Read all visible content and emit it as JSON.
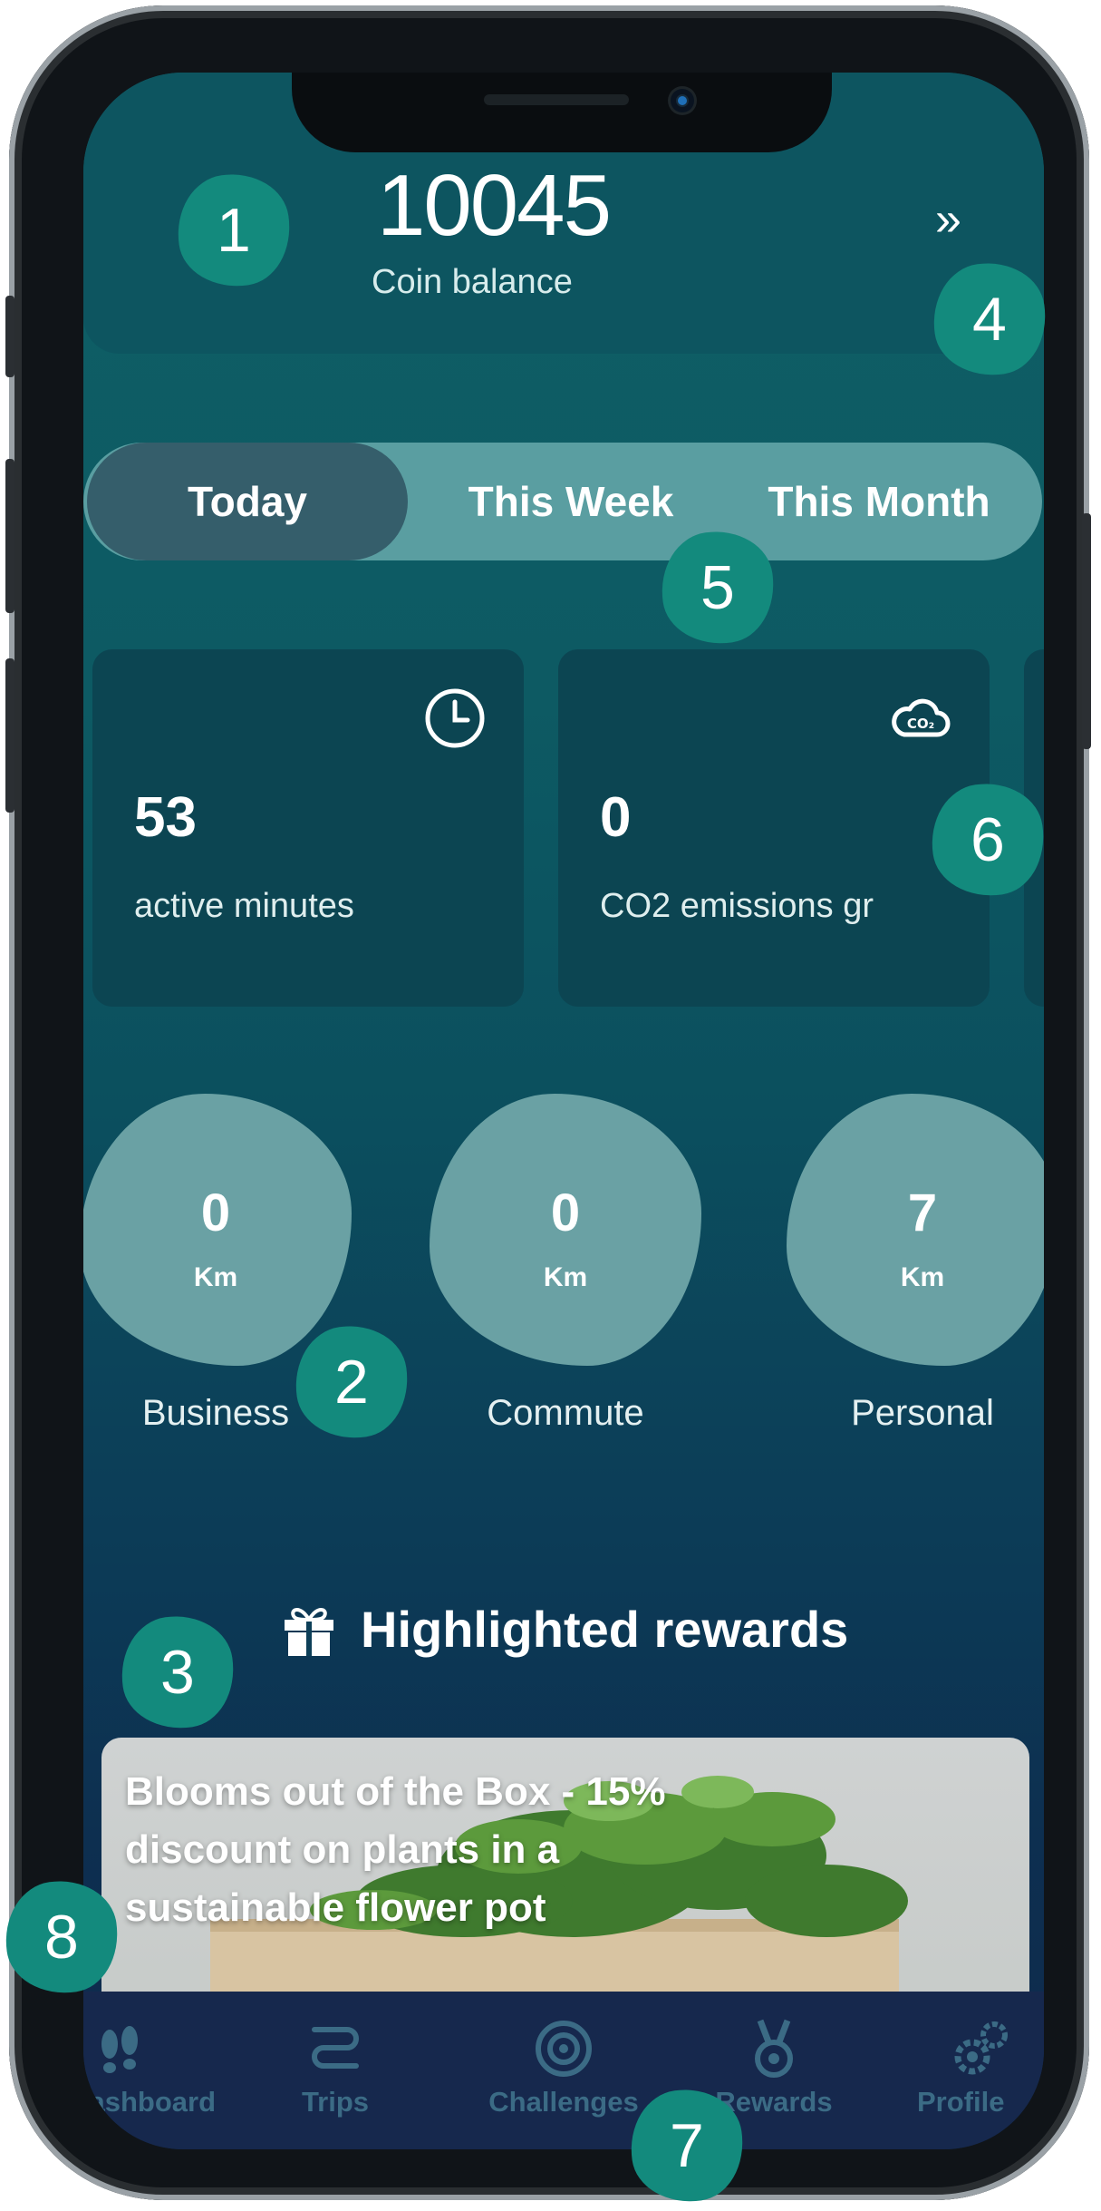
{
  "header": {
    "coin_value": "10045",
    "coin_label": "Coin balance",
    "expand_label": "»"
  },
  "period_tabs": [
    {
      "label": "Today",
      "active": true
    },
    {
      "label": "This Week",
      "active": false
    },
    {
      "label": "This Month",
      "active": false
    }
  ],
  "stats": [
    {
      "value": "53",
      "label": "active minutes",
      "icon": "clock-icon"
    },
    {
      "value": "0",
      "label": "CO2 emissions gr",
      "icon": "co2-cloud-icon"
    }
  ],
  "trip_types": [
    {
      "value": "0",
      "unit": "Km",
      "label": "Business"
    },
    {
      "value": "0",
      "unit": "Km",
      "label": "Commute"
    },
    {
      "value": "7",
      "unit": "Km",
      "label": "Personal"
    }
  ],
  "rewards": {
    "title": "Highlighted rewards",
    "icon": "gift-icon",
    "card_text": "Blooms out of the Box - 15% discount on plants in a sustainable flower pot"
  },
  "nav": [
    {
      "label": "ashboard",
      "icon": "footprints-icon"
    },
    {
      "label": "Trips",
      "icon": "route-icon"
    },
    {
      "label": "Challenges",
      "icon": "target-icon"
    },
    {
      "label": "Rewards",
      "icon": "medal-icon"
    },
    {
      "label": "Profile",
      "icon": "gears-icon"
    }
  ],
  "markers": [
    "1",
    "2",
    "3",
    "4",
    "5",
    "6",
    "7",
    "8"
  ],
  "colors": {
    "marker": "#138a7d",
    "screen_top": "#0e5f66",
    "screen_bottom": "#0f2a4c",
    "nav_bg": "#16284d",
    "segment_active": "#355e6b"
  }
}
